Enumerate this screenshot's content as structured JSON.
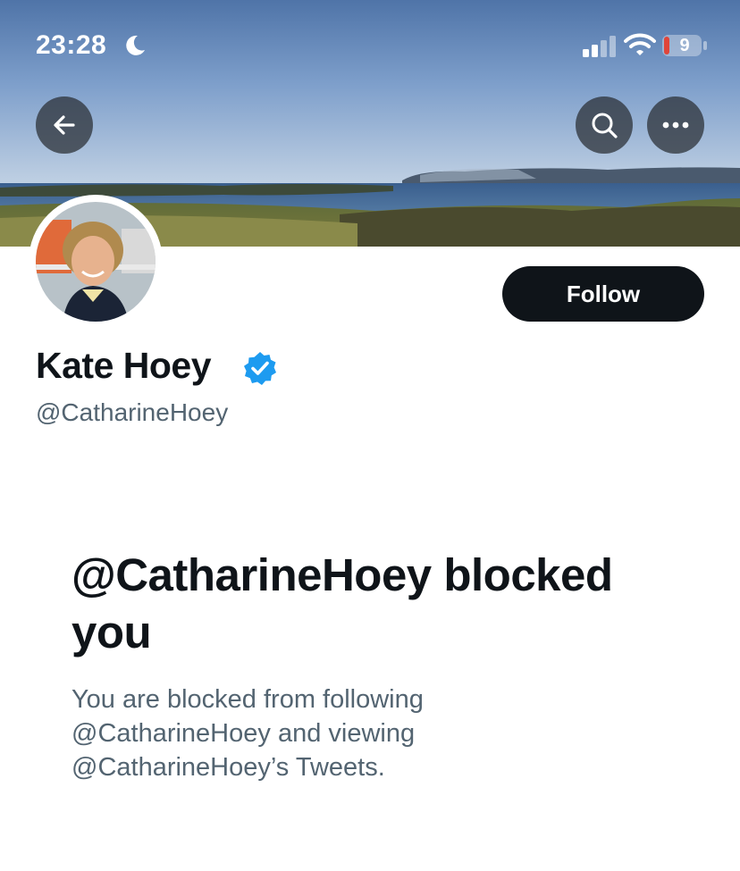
{
  "status_bar": {
    "time": "23:28",
    "battery_level": "9",
    "icons": [
      "moon-icon",
      "signal-icon",
      "wifi-icon",
      "battery-icon"
    ]
  },
  "header": {
    "icons": [
      "back-arrow-icon",
      "search-icon",
      "more-icon"
    ]
  },
  "profile": {
    "display_name": "Kate Hoey",
    "handle": "@CatharineHoey",
    "follow_label": "Follow",
    "verified_icon": "verified-badge-icon"
  },
  "blocked": {
    "title": "@CatharineHoey blocked you",
    "description": "You are blocked from following @CatharineHoey and viewing @CatharineHoey’s Tweets."
  },
  "colors": {
    "primary_text": "#0f1419",
    "secondary_text": "#536471",
    "verified_blue": "#1d9bf0",
    "follow_button_bg": "#0f1419",
    "battery_low": "#e0453a"
  }
}
